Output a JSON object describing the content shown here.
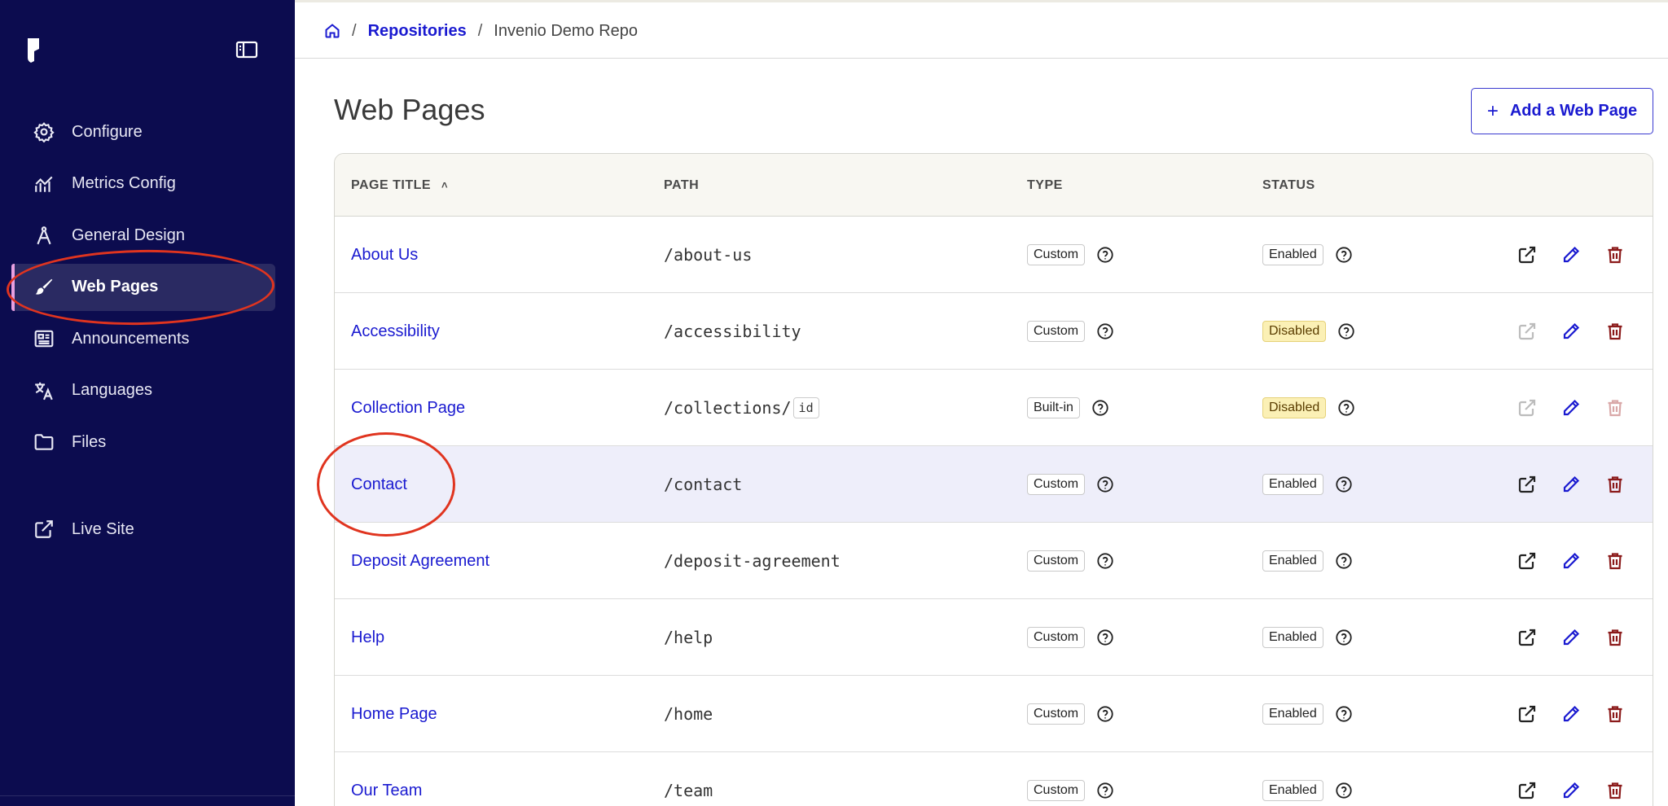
{
  "breadcrumb": {
    "repositories": "Repositories",
    "current": "Invenio Demo Repo",
    "sep": "/"
  },
  "page": {
    "title": "Web Pages",
    "add_button": "Add a Web Page",
    "plus": "+"
  },
  "sidebar": {
    "items": [
      {
        "label": "Configure",
        "icon": "gear-icon"
      },
      {
        "label": "Metrics Config",
        "icon": "chart-icon"
      },
      {
        "label": "General Design",
        "icon": "compass-icon"
      },
      {
        "label": "Web Pages",
        "icon": "brush-icon",
        "active": true
      },
      {
        "label": "Announcements",
        "icon": "newspaper-icon"
      },
      {
        "label": "Languages",
        "icon": "translate-icon"
      },
      {
        "label": "Files",
        "icon": "folder-icon"
      }
    ],
    "live_site": "Live Site"
  },
  "table": {
    "headers": {
      "title": "PAGE TITLE",
      "sort": "˄",
      "path": "PATH",
      "type": "TYPE",
      "status": "STATUS"
    },
    "rows": [
      {
        "title": "About Us",
        "path": "/about-us",
        "type": "Custom",
        "status": "Enabled"
      },
      {
        "title": "Accessibility",
        "path": "/accessibility",
        "type": "Custom",
        "status": "Disabled"
      },
      {
        "title": "Collection Page",
        "path": "/collections/",
        "path_param": "id",
        "type": "Built-in",
        "status": "Disabled"
      },
      {
        "title": "Contact",
        "path": "/contact",
        "type": "Custom",
        "status": "Enabled"
      },
      {
        "title": "Deposit Agreement",
        "path": "/deposit-agreement",
        "type": "Custom",
        "status": "Enabled"
      },
      {
        "title": "Help",
        "path": "/help",
        "type": "Custom",
        "status": "Enabled"
      },
      {
        "title": "Home Page",
        "path": "/home",
        "type": "Custom",
        "status": "Enabled"
      },
      {
        "title": "Our Team",
        "path": "/team",
        "type": "Custom",
        "status": "Enabled"
      }
    ]
  },
  "colors": {
    "sidebar_bg": "#0c0c4f",
    "link": "#1a1ad0",
    "delete": "#8b1a1a",
    "annotation": "#e0341f",
    "disabled_badge": "#fbf0b5"
  }
}
